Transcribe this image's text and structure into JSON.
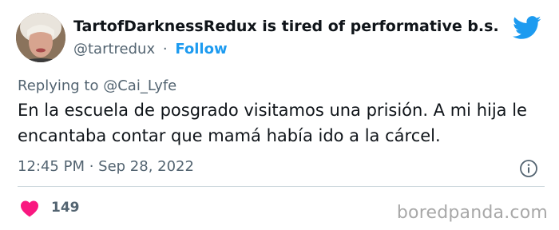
{
  "author": {
    "display_name": "TartofDarknessRedux is tired of performative b.s.",
    "handle": "@tartredux",
    "separator": "·",
    "follow_label": "Follow"
  },
  "reply": {
    "prefix": "Replying to",
    "mention": "@Cai_Lyfe"
  },
  "tweet": {
    "text": "En la escuela de posgrado visitamos una prisión. A mi hija le encantaba contar que mamá había ido a la cárcel.",
    "timestamp": "12:45 PM · Sep 28, 2022"
  },
  "engagement": {
    "likes": "149"
  },
  "watermark": "boredpanda.com",
  "icons": {
    "platform": "twitter-bird-icon",
    "info": "info-icon",
    "like": "heart-icon"
  },
  "colors": {
    "accent": "#1d9bf0",
    "like": "#f91880",
    "muted": "#536471"
  }
}
